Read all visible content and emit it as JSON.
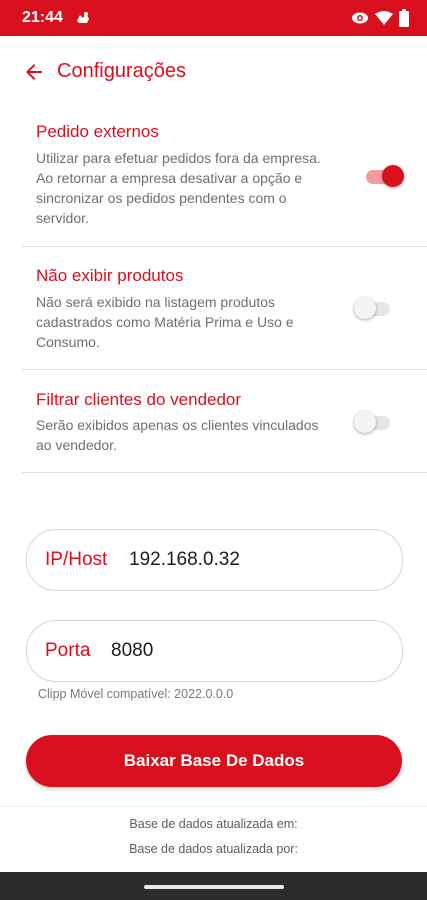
{
  "status_bar": {
    "time": "21:44",
    "notification_icon": "android-notification-icon",
    "icons": [
      "eye-icon",
      "wifi-icon",
      "battery-icon"
    ],
    "color": "#d8101e"
  },
  "header": {
    "title": "Configurações"
  },
  "settings": [
    {
      "title": "Pedido externos",
      "description": "Utilizar para efetuar pedidos fora da empresa. Ao retornar a empresa desativar a opção e sincronizar os pedidos pendentes com o servidor.",
      "enabled": true
    },
    {
      "title": "Não exibir produtos",
      "description": "Não será exibido na listagem produtos cadastrados como Matéria Prima e Uso e Consumo.",
      "enabled": false
    },
    {
      "title": "Filtrar clientes do vendedor",
      "description": "Serão exibidos apenas os clientes vinculados ao vendedor.",
      "enabled": false
    }
  ],
  "fields": {
    "ip": {
      "label": "IP/Host",
      "value": "192.168.0.32"
    },
    "port": {
      "label": "Porta",
      "value": "8080"
    }
  },
  "compat_text": "Clipp Móvel compatível: 2022.0.0.0",
  "download_button": "Baixar Base De Dados",
  "footer": {
    "updated_at": "Base de dados atualizada em:",
    "updated_by": "Base de dados atualizada por:"
  },
  "colors": {
    "accent": "#d8101e",
    "text_secondary": "#6f6f6f"
  }
}
